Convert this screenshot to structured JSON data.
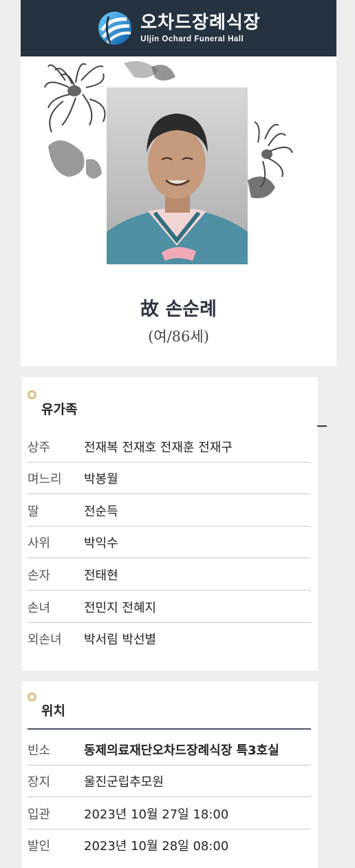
{
  "header": {
    "title": "오차드장례식장",
    "subtitle": "Uljin Ochard Funeral Hall"
  },
  "deceased": {
    "name": "故 손순례",
    "age": "(여/86세)"
  },
  "family": {
    "title": "유가족",
    "rows": [
      {
        "label": "상주",
        "value": "전재복 전재호 전재훈 전재구"
      },
      {
        "label": "며느리",
        "value": "박봉월"
      },
      {
        "label": "딸",
        "value": "전순득"
      },
      {
        "label": "사위",
        "value": "박익수"
      },
      {
        "label": "손자",
        "value": "전태현"
      },
      {
        "label": "손녀",
        "value": "전민지 전혜지"
      },
      {
        "label": "외손녀",
        "value": "박서림 박선별"
      }
    ]
  },
  "location": {
    "title": "위치",
    "rows": [
      {
        "label": "빈소",
        "value": "동제의료재단오차드장례식장 특3호실"
      },
      {
        "label": "장지",
        "value": "울진군립추모원"
      },
      {
        "label": "입관",
        "value": "2023년 10월 27일 18:00"
      },
      {
        "label": "발인",
        "value": "2023년 10월 28일 08:00"
      }
    ]
  },
  "colors": {
    "header_bg": "#253240",
    "accent_gold": "#d9c07e",
    "name_text": "#2d3542"
  },
  "icons": {
    "logo": "globe-logo-icon",
    "collapse": "minus-icon",
    "section_marker": "circle-marker-icon"
  }
}
